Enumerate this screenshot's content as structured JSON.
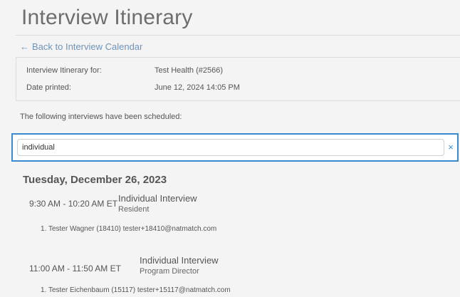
{
  "page": {
    "title": "Interview Itinerary",
    "back_link": "Back to Interview Calendar"
  },
  "info": {
    "itinerary_label": "Interview Itinerary for:",
    "itinerary_value": "Test Health (#2566)",
    "printed_label": "Date printed:",
    "printed_value": "June 12, 2024 14:05 PM"
  },
  "intro_text": "The following interviews have been scheduled:",
  "search": {
    "value": "individual",
    "clear_glyph": "×"
  },
  "schedule": {
    "day": "Tuesday, December 26, 2023",
    "slots": [
      {
        "time": "9:30 AM - 10:20 AM ET",
        "type": "Individual Interview",
        "role": "Resident",
        "attendee": "1. Tester Wagner  (18410)  tester+18410@natmatch.com"
      },
      {
        "time": "11:00 AM - 11:50 AM ET",
        "type": "Individual Interview",
        "role": "Program Director",
        "attendee": "1. Tester Eichenbaum  (15117)  tester+15117@natmatch.com"
      }
    ]
  },
  "colors": {
    "link": "#6f93b8",
    "focus_border": "#3b8ad0"
  },
  "icons": {
    "back": "left-arrow-icon",
    "clear": "close-icon"
  }
}
